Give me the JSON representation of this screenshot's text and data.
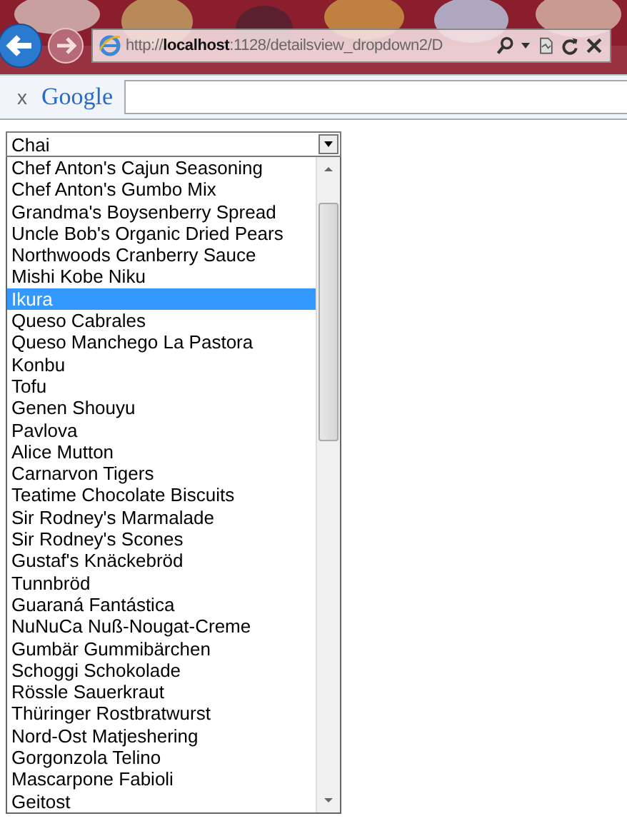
{
  "address_bar": {
    "url": "http://**localhost**:1128/detailsview_dropdown2/D"
  },
  "google_bar": {
    "close": "x",
    "logo": "Google"
  },
  "dropdown": {
    "value": "Chai",
    "options": [
      {
        "label": "Chef Anton's Cajun Seasoning",
        "selected": false
      },
      {
        "label": "Chef Anton's Gumbo Mix",
        "selected": false
      },
      {
        "label": "Grandma's Boysenberry Spread",
        "selected": false
      },
      {
        "label": "Uncle Bob's Organic Dried Pears",
        "selected": false
      },
      {
        "label": "Northwoods Cranberry Sauce",
        "selected": false
      },
      {
        "label": "Mishi Kobe Niku",
        "selected": false
      },
      {
        "label": "Ikura",
        "selected": true
      },
      {
        "label": "Queso Cabrales",
        "selected": false
      },
      {
        "label": "Queso Manchego La Pastora",
        "selected": false
      },
      {
        "label": "Konbu",
        "selected": false
      },
      {
        "label": "Tofu",
        "selected": false
      },
      {
        "label": "Genen Shouyu",
        "selected": false
      },
      {
        "label": "Pavlova",
        "selected": false
      },
      {
        "label": "Alice Mutton",
        "selected": false
      },
      {
        "label": "Carnarvon Tigers",
        "selected": false
      },
      {
        "label": "Teatime Chocolate Biscuits",
        "selected": false
      },
      {
        "label": "Sir Rodney's Marmalade",
        "selected": false
      },
      {
        "label": "Sir Rodney's Scones",
        "selected": false
      },
      {
        "label": "Gustaf's Knäckebröd",
        "selected": false
      },
      {
        "label": "Tunnbröd",
        "selected": false
      },
      {
        "label": "Guaraná Fantástica",
        "selected": false
      },
      {
        "label": "NuNuCa Nuß-Nougat-Creme",
        "selected": false
      },
      {
        "label": "Gumbär Gummibärchen",
        "selected": false
      },
      {
        "label": "Schoggi Schokolade",
        "selected": false
      },
      {
        "label": "Rössle Sauerkraut",
        "selected": false
      },
      {
        "label": "Thüringer Rostbratwurst",
        "selected": false
      },
      {
        "label": "Nord-Ost Matjeshering",
        "selected": false
      },
      {
        "label": "Gorgonzola Telino",
        "selected": false
      },
      {
        "label": "Mascarpone Fabioli",
        "selected": false
      },
      {
        "label": "Geitost",
        "selected": false
      }
    ]
  }
}
